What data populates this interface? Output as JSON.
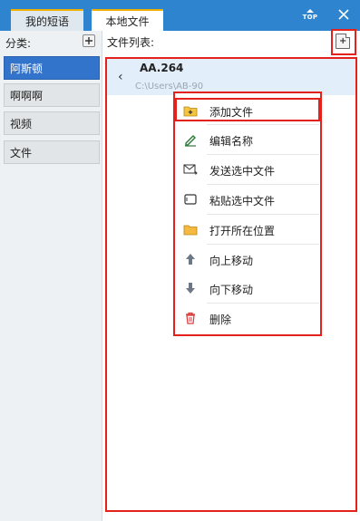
{
  "tabs": {
    "my_phrases": "我的短语",
    "local_files": "本地文件"
  },
  "window": {
    "top_label": "TOP",
    "close_symbol": "✕"
  },
  "left": {
    "category_label": "分类:",
    "categories": [
      "阿斯顿",
      "啊啊啊",
      "视频",
      "文件"
    ],
    "active_index": 0
  },
  "right": {
    "list_label": "文件列表:",
    "file": {
      "name": "AA.264",
      "path": "C:\\Users\\AB-90"
    }
  },
  "context_menu": {
    "items": [
      {
        "label": "添加文件",
        "icon": "folder-add-icon"
      },
      {
        "label": "编辑名称",
        "icon": "edit-icon"
      },
      {
        "label": "发送选中文件",
        "icon": "send-mail-icon"
      },
      {
        "label": "粘贴选中文件",
        "icon": "paste-icon"
      },
      {
        "label": "打开所在位置",
        "icon": "folder-open-icon"
      },
      {
        "label": "向上移动",
        "icon": "arrow-up-icon"
      },
      {
        "label": "向下移动",
        "icon": "arrow-down-icon"
      },
      {
        "label": "删除",
        "icon": "trash-icon"
      }
    ]
  },
  "colors": {
    "titlebar": "#2f84cf",
    "active_tab_accent": "#f0b000",
    "selected_category": "#3273cc",
    "highlight_border": "#e5211b",
    "file_entry_bg": "#e2eefa"
  }
}
